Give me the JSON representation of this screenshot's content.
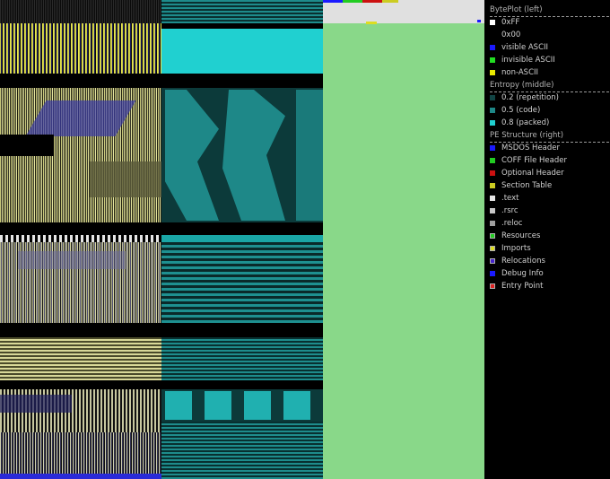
{
  "bytePlot": {
    "title": "BytePlot (left)",
    "items": [
      {
        "label": "0xFF",
        "color": "#ffffff"
      },
      {
        "label": "0x00",
        "color": "#000000"
      },
      {
        "label": "visible ASCII",
        "color": "#1a1aff"
      },
      {
        "label": "invisible ASCII",
        "color": "#22dd22"
      },
      {
        "label": "non-ASCII",
        "color": "#e8e800"
      }
    ]
  },
  "entropy": {
    "title": "Entropy (middle)",
    "items": [
      {
        "label": "0.2 (repetition)",
        "color": "#114444"
      },
      {
        "label": "0.5 (code)",
        "color": "#1e8888"
      },
      {
        "label": "0.8 (packed)",
        "color": "#20d0d0"
      }
    ]
  },
  "peStructure": {
    "title": "PE Structure (right)",
    "items": [
      {
        "label": "MSDOS Header",
        "color": "#1a1aff",
        "outlined": false
      },
      {
        "label": "COFF File Header",
        "color": "#22cc22",
        "outlined": false
      },
      {
        "label": "Optional Header",
        "color": "#cc1111",
        "outlined": false
      },
      {
        "label": "Section Table",
        "color": "#cccc22",
        "outlined": false
      },
      {
        "label": ".text",
        "color": "#e6e6e6",
        "outlined": false
      },
      {
        "label": ".rsrc",
        "color": "#c8c8c8",
        "outlined": false
      },
      {
        "label": ".reloc",
        "color": "#a0a0a0",
        "outlined": false
      },
      {
        "label": "Resources",
        "color": "#22cc22",
        "outlined": true
      },
      {
        "label": "Imports",
        "color": "#dddd22",
        "outlined": true
      },
      {
        "label": "Relocations",
        "color": "#4422cc",
        "outlined": true
      },
      {
        "label": "Debug Info",
        "color": "#1a1aff",
        "outlined": false
      },
      {
        "label": "Entry Point",
        "color": "#dd2222",
        "outlined": true
      }
    ]
  }
}
